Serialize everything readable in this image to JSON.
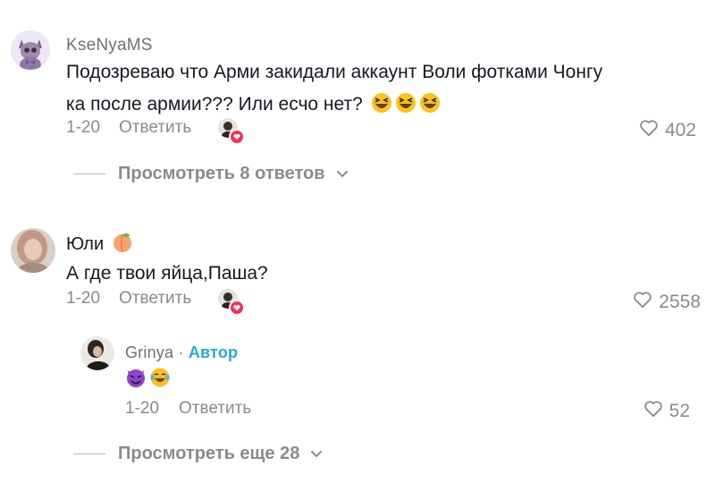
{
  "comments": [
    {
      "username": "KseNyaMS",
      "text_line1": "Подозреваю что Арми закидали аккаунт Воли фотками Чонгу",
      "text_line2": "ка после армии??? Или есчо нет?",
      "emojis": [
        "laughing-squint",
        "laughing-squint",
        "laughing-squint"
      ],
      "date": "1-20",
      "reply_label": "Ответить",
      "likes": "402",
      "view_replies": "Просмотреть 8 ответов"
    },
    {
      "username": "Юли",
      "username_emoji": "peach",
      "text": "А где твои яйца,Паша?",
      "date": "1-20",
      "reply_label": "Ответить",
      "likes": "2558",
      "replies": [
        {
          "username": "Grinya",
          "separator": "·",
          "author_label": "Автор",
          "emojis": [
            "smiling-imp",
            "tears-of-joy"
          ],
          "date": "1-20",
          "reply_label": "Ответить",
          "likes": "52"
        }
      ],
      "view_more": "Просмотреть еще 28"
    }
  ],
  "colors": {
    "text": "#161823",
    "muted": "#8a8b91",
    "author": "#2aa7d6",
    "like_badge": "#fe2c55"
  }
}
